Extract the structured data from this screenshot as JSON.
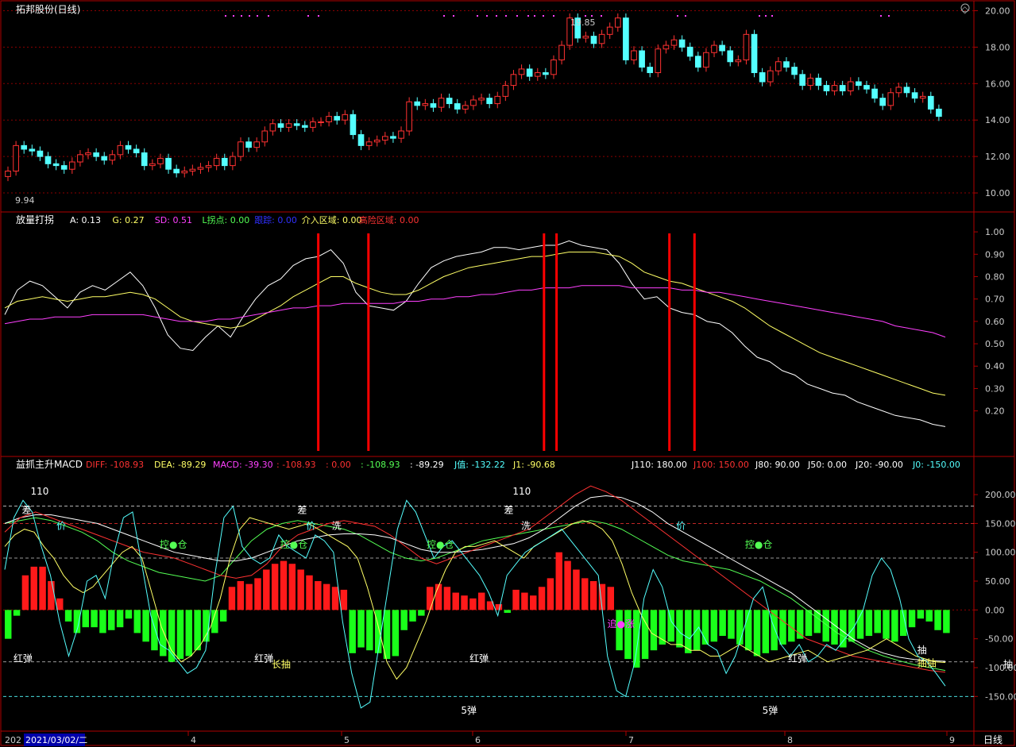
{
  "title": "拓邦股份(日线)",
  "period_label": "日线",
  "date_cursor": "2021/03/02/二",
  "date_prefix": "202",
  "x_axis_labels": [
    "4",
    "5",
    "6",
    "7",
    "8",
    "9"
  ],
  "colors": {
    "up": "#ff3232",
    "down": "#54ffff",
    "grid": "#8b0000",
    "frame": "#b00000",
    "bg": "#000000"
  },
  "chart_data": [
    {
      "type": "candlestick",
      "title": "拓邦股份(日线)",
      "ylim": [
        9.0,
        20.5
      ],
      "yticks": [
        "10.00",
        "12.00",
        "14.00",
        "16.00",
        "18.00",
        "20.00"
      ],
      "high_label": "19.85",
      "low_label": "9.94",
      "closes": [
        11.2,
        12.6,
        12.4,
        12.3,
        12.0,
        11.6,
        11.5,
        11.3,
        11.7,
        12.1,
        12.2,
        12.0,
        11.8,
        12.1,
        12.6,
        12.4,
        12.2,
        11.5,
        11.6,
        11.9,
        11.3,
        11.1,
        11.2,
        11.3,
        11.4,
        11.5,
        11.9,
        11.5,
        12.0,
        12.8,
        12.5,
        12.8,
        13.4,
        13.8,
        13.6,
        13.8,
        13.7,
        13.6,
        13.9,
        13.9,
        14.2,
        14.0,
        14.3,
        13.2,
        12.6,
        12.8,
        12.9,
        13.1,
        13.0,
        13.4,
        15.0,
        14.8,
        14.9,
        14.7,
        15.2,
        14.9,
        14.6,
        14.8,
        15.1,
        15.2,
        14.9,
        15.3,
        15.9,
        16.5,
        16.8,
        16.4,
        16.6,
        16.5,
        17.3,
        18.1,
        19.6,
        18.5,
        18.6,
        18.2,
        18.7,
        19.1,
        19.6,
        17.3,
        17.8,
        16.9,
        16.6,
        17.9,
        18.1,
        18.4,
        18.0,
        17.5,
        16.9,
        17.7,
        18.1,
        17.8,
        17.2,
        17.3,
        18.7,
        16.6,
        16.1,
        16.7,
        17.2,
        16.9,
        16.5,
        15.9,
        16.3,
        15.9,
        15.6,
        15.9,
        15.6,
        16.1,
        15.9,
        15.7,
        15.2,
        14.8,
        15.5,
        15.8,
        15.5,
        15.2,
        15.3,
        14.6,
        14.2
      ]
    },
    {
      "type": "line",
      "title": "放量打拐",
      "ylim": [
        0.0,
        1.05
      ],
      "yticks": [
        "0.20",
        "0.30",
        "0.40",
        "0.50",
        "0.60",
        "0.70",
        "0.80",
        "0.90",
        "1.00"
      ],
      "legend": [
        {
          "label": "A:",
          "value": "0.13",
          "color": "#ffffff"
        },
        {
          "label": "G:",
          "value": "0.27",
          "color": "#ffff66"
        },
        {
          "label": "SD:",
          "value": "0.51",
          "color": "#ff40ff"
        },
        {
          "label": "L拐点:",
          "value": "0.00",
          "color": "#54ff54"
        },
        {
          "label": "跟踪:",
          "value": "0.00",
          "color": "#3030ff"
        },
        {
          "label": "介入区域:",
          "value": "0.00",
          "color": "#ffff66"
        },
        {
          "label": "高险区域:",
          "value": "0.00",
          "color": "#ff3232"
        }
      ],
      "series": [
        {
          "name": "A",
          "color": "#ffffff",
          "values": [
            0.63,
            0.74,
            0.78,
            0.76,
            0.71,
            0.66,
            0.73,
            0.76,
            0.74,
            0.78,
            0.82,
            0.76,
            0.66,
            0.54,
            0.48,
            0.47,
            0.53,
            0.58,
            0.53,
            0.62,
            0.7,
            0.76,
            0.79,
            0.85,
            0.88,
            0.89,
            0.92,
            0.86,
            0.73,
            0.67,
            0.66,
            0.65,
            0.69,
            0.77,
            0.84,
            0.87,
            0.89,
            0.9,
            0.91,
            0.93,
            0.93,
            0.92,
            0.93,
            0.94,
            0.94,
            0.96,
            0.94,
            0.93,
            0.92,
            0.86,
            0.77,
            0.7,
            0.71,
            0.66,
            0.64,
            0.63,
            0.6,
            0.59,
            0.55,
            0.49,
            0.44,
            0.42,
            0.38,
            0.36,
            0.32,
            0.3,
            0.28,
            0.27,
            0.24,
            0.22,
            0.2,
            0.18,
            0.17,
            0.16,
            0.14,
            0.13
          ]
        },
        {
          "name": "G",
          "color": "#ffff66",
          "values": [
            0.66,
            0.69,
            0.7,
            0.71,
            0.7,
            0.69,
            0.7,
            0.71,
            0.71,
            0.72,
            0.73,
            0.72,
            0.7,
            0.66,
            0.62,
            0.6,
            0.59,
            0.58,
            0.57,
            0.58,
            0.61,
            0.64,
            0.67,
            0.71,
            0.74,
            0.77,
            0.8,
            0.8,
            0.77,
            0.75,
            0.73,
            0.72,
            0.72,
            0.74,
            0.77,
            0.8,
            0.82,
            0.84,
            0.85,
            0.86,
            0.87,
            0.88,
            0.89,
            0.89,
            0.9,
            0.91,
            0.91,
            0.91,
            0.9,
            0.89,
            0.86,
            0.82,
            0.8,
            0.78,
            0.77,
            0.75,
            0.73,
            0.71,
            0.69,
            0.66,
            0.62,
            0.58,
            0.55,
            0.52,
            0.49,
            0.46,
            0.44,
            0.42,
            0.4,
            0.38,
            0.36,
            0.34,
            0.32,
            0.3,
            0.28,
            0.27
          ]
        },
        {
          "name": "SD",
          "color": "#ff40ff",
          "values": [
            0.59,
            0.6,
            0.61,
            0.61,
            0.62,
            0.62,
            0.62,
            0.63,
            0.63,
            0.63,
            0.63,
            0.63,
            0.62,
            0.61,
            0.6,
            0.6,
            0.6,
            0.61,
            0.61,
            0.62,
            0.63,
            0.64,
            0.65,
            0.66,
            0.66,
            0.67,
            0.67,
            0.68,
            0.68,
            0.68,
            0.68,
            0.68,
            0.69,
            0.69,
            0.7,
            0.7,
            0.71,
            0.71,
            0.72,
            0.72,
            0.73,
            0.74,
            0.74,
            0.75,
            0.75,
            0.75,
            0.76,
            0.76,
            0.76,
            0.76,
            0.75,
            0.75,
            0.75,
            0.75,
            0.74,
            0.74,
            0.73,
            0.73,
            0.72,
            0.71,
            0.7,
            0.69,
            0.68,
            0.67,
            0.66,
            0.65,
            0.64,
            0.63,
            0.62,
            0.61,
            0.6,
            0.58,
            0.57,
            0.56,
            0.55,
            0.53
          ]
        }
      ],
      "signal_bar_indices": [
        25,
        29,
        43,
        44,
        53,
        55
      ]
    },
    {
      "type": "bar",
      "title": "益抓主升MACD",
      "ylim": [
        -195,
        240
      ],
      "yticks": [
        "-150.00",
        "-100.00",
        "-50.00",
        "0.00",
        "50.00",
        "100.00",
        "150.00",
        "200.00"
      ],
      "legend": [
        {
          "label": "DIFF:",
          "value": "-108.93",
          "color": "#ff3232"
        },
        {
          "label": "DEA:",
          "value": "-89.29",
          "color": "#ffff66"
        },
        {
          "label": "MACD:",
          "value": "-39.30",
          "color": "#ff40ff"
        },
        {
          "label": ":",
          "value": "-108.93",
          "color": "#ff3232"
        },
        {
          "label": ":",
          "value": "0.00",
          "color": "#ff3232"
        },
        {
          "label": ":",
          "value": "-108.93",
          "color": "#54ff54"
        },
        {
          "label": ":",
          "value": "-89.29",
          "color": "#ffffff"
        },
        {
          "label": "J值:",
          "value": "-132.22",
          "color": "#54ffff"
        },
        {
          "label": "J1:",
          "value": "-90.68",
          "color": "#ffff66"
        }
      ],
      "legend_right": [
        {
          "label": "J110:",
          "value": "180.00",
          "color": "#ffffff"
        },
        {
          "label": "J100:",
          "value": "150.00",
          "color": "#ff3232"
        },
        {
          "label": "J80:",
          "value": "90.00",
          "color": "#ffffff"
        },
        {
          "label": "J50:",
          "value": "0.00",
          "color": "#ffffff"
        },
        {
          "label": "J20:",
          "value": "-90.00",
          "color": "#ffffff"
        },
        {
          "label": "J0:",
          "value": "-150.00",
          "color": "#54ffff"
        }
      ],
      "hlines": [
        180,
        150,
        90,
        -90,
        -150
      ],
      "histogram": [
        -50,
        -10,
        60,
        75,
        75,
        50,
        20,
        -20,
        -40,
        -30,
        -30,
        -40,
        -35,
        -30,
        -15,
        -40,
        -55,
        -70,
        -80,
        -90,
        -85,
        -80,
        -70,
        -55,
        -40,
        -20,
        40,
        50,
        45,
        55,
        70,
        80,
        85,
        80,
        70,
        60,
        50,
        45,
        40,
        35,
        -75,
        -65,
        -70,
        -75,
        -85,
        -80,
        -35,
        -20,
        -10,
        40,
        45,
        40,
        30,
        25,
        20,
        30,
        15,
        10,
        -5,
        35,
        30,
        25,
        40,
        55,
        100,
        85,
        70,
        55,
        50,
        45,
        40,
        -70,
        -85,
        -100,
        -85,
        -70,
        -60,
        -55,
        -65,
        -75,
        -70,
        -60,
        -55,
        -45,
        -50,
        -60,
        -70,
        -80,
        -75,
        -70,
        -60,
        -55,
        -50,
        -45,
        -40,
        -55,
        -60,
        -65,
        -55,
        -50,
        -45,
        -40,
        -50,
        -55,
        -45,
        -30,
        -15,
        -20,
        -35,
        -40
      ],
      "j_values": [
        70,
        160,
        190,
        170,
        110,
        60,
        -20,
        -80,
        -30,
        50,
        60,
        20,
        100,
        160,
        170,
        80,
        -10,
        -60,
        -70,
        -90,
        -110,
        -100,
        -70,
        60,
        160,
        180,
        110,
        90,
        80,
        90,
        130,
        110,
        100,
        90,
        130,
        120,
        100,
        -20,
        -110,
        -170,
        -160,
        -60,
        40,
        140,
        190,
        170,
        130,
        90,
        110,
        120,
        100,
        80,
        60,
        30,
        -10,
        60,
        80,
        100,
        110,
        120,
        130,
        140,
        120,
        100,
        80,
        60,
        -80,
        -140,
        -150,
        -90,
        20,
        70,
        40,
        -20,
        -40,
        -50,
        -30,
        -60,
        -70,
        -110,
        -80,
        -30,
        20,
        40,
        -20,
        -60,
        -80,
        -60,
        -90,
        -80,
        -60,
        -70,
        -50,
        -30,
        0,
        60,
        90,
        70,
        20,
        -50,
        -80,
        -90,
        -110,
        -132
      ],
      "j1_values": [
        110,
        130,
        140,
        135,
        110,
        90,
        60,
        40,
        30,
        40,
        60,
        80,
        100,
        110,
        90,
        30,
        -30,
        -70,
        -90,
        -80,
        -60,
        -30,
        20,
        90,
        140,
        160,
        155,
        150,
        145,
        140,
        145,
        150,
        140,
        130,
        120,
        110,
        90,
        40,
        -20,
        -90,
        -120,
        -100,
        -60,
        -20,
        30,
        70,
        100,
        110,
        110,
        115,
        120,
        110,
        100,
        90,
        110,
        120,
        130,
        140,
        150,
        155,
        150,
        140,
        120,
        80,
        30,
        -10,
        -40,
        -50,
        -60,
        -60,
        -70,
        -70,
        -80,
        -80,
        -70,
        -60,
        -70,
        -80,
        -90,
        -85,
        -80,
        -75,
        -70,
        -80,
        -90,
        -85,
        -80,
        -75,
        -70,
        -60,
        -50,
        -60,
        -70,
        -80,
        -85,
        -90,
        -91
      ],
      "diff_values": [
        135,
        160,
        170,
        160,
        150,
        140,
        130,
        120,
        110,
        100,
        95,
        90,
        80,
        70,
        60,
        55,
        60,
        80,
        110,
        130,
        140,
        150,
        155,
        150,
        145,
        130,
        110,
        90,
        80,
        90,
        100,
        110,
        120,
        130,
        140,
        160,
        180,
        200,
        215,
        205,
        190,
        170,
        150,
        130,
        110,
        90,
        70,
        50,
        30,
        10,
        -10,
        -30,
        -50,
        -60,
        -70,
        -80,
        -85,
        -90,
        -95,
        -100,
        -105,
        -108
      ],
      "dea_values": [
        150,
        160,
        165,
        165,
        160,
        155,
        150,
        140,
        130,
        120,
        110,
        100,
        95,
        90,
        85,
        85,
        90,
        100,
        110,
        120,
        125,
        130,
        132,
        132,
        130,
        125,
        115,
        105,
        100,
        100,
        102,
        105,
        110,
        115,
        125,
        140,
        160,
        180,
        195,
        198,
        195,
        185,
        170,
        150,
        135,
        120,
        105,
        90,
        75,
        60,
        45,
        30,
        10,
        -10,
        -30,
        -50,
        -65,
        -75,
        -82,
        -86,
        -88,
        -89
      ],
      "green_values": [
        150,
        155,
        160,
        155,
        145,
        135,
        120,
        100,
        85,
        75,
        65,
        60,
        55,
        50,
        60,
        90,
        120,
        140,
        150,
        155,
        150,
        145,
        140,
        130,
        115,
        100,
        90,
        85,
        90,
        100,
        110,
        120,
        125,
        130,
        135,
        140,
        145,
        150,
        155,
        150,
        140,
        125,
        110,
        95,
        85,
        80,
        75,
        70,
        60,
        50,
        35,
        20,
        0,
        -20,
        -40,
        -55,
        -70,
        -80,
        -88,
        -95,
        -100,
        -105
      ],
      "labels": [
        {
          "text": "110",
          "color": "#ffffff",
          "i": 3,
          "v": 200
        },
        {
          "text": "差",
          "color": "#ffffff",
          "i": 2,
          "v": 168
        },
        {
          "text": "价",
          "color": "#54ffff",
          "i": 6,
          "v": 140
        },
        {
          "text": "控●仓",
          "color": "#54ff54",
          "i": 18,
          "v": 108
        },
        {
          "text": "差",
          "color": "#ffffff",
          "i": 34,
          "v": 168
        },
        {
          "text": "价",
          "color": "#54ffff",
          "i": 35,
          "v": 140
        },
        {
          "text": "洗",
          "color": "#ffffff",
          "i": 38,
          "v": 140
        },
        {
          "text": "控●仓",
          "color": "#54ff54",
          "i": 32,
          "v": 108
        },
        {
          "text": "控●仓",
          "color": "#54ff54",
          "i": 49,
          "v": 108
        },
        {
          "text": "110",
          "color": "#ffffff",
          "i": 59,
          "v": 200
        },
        {
          "text": "差",
          "color": "#ffffff",
          "i": 58,
          "v": 168
        },
        {
          "text": "洗",
          "color": "#ffffff",
          "i": 60,
          "v": 140
        },
        {
          "text": "价",
          "color": "#54ffff",
          "i": 78,
          "v": 140
        },
        {
          "text": "控●仓",
          "color": "#54ff54",
          "i": 86,
          "v": 108
        },
        {
          "text": "追●涨",
          "color": "#ff40ff",
          "i": 70,
          "v": -30
        },
        {
          "text": "红弹",
          "color": "#ffffff",
          "i": 1,
          "v": -90
        },
        {
          "text": "红弹",
          "color": "#ffffff",
          "i": 29,
          "v": -90
        },
        {
          "text": "长抽",
          "color": "#ffff66",
          "i": 31,
          "v": -100
        },
        {
          "text": "红弹",
          "color": "#ffffff",
          "i": 54,
          "v": -90
        },
        {
          "text": "5弹",
          "color": "#ffffff",
          "i": 53,
          "v": -180
        },
        {
          "text": "红弹",
          "color": "#ffffff",
          "i": 91,
          "v": -90
        },
        {
          "text": "5弹",
          "color": "#ffffff",
          "i": 88,
          "v": -180
        },
        {
          "text": "抽",
          "color": "#ffffff",
          "i": 106,
          "v": -75
        },
        {
          "text": "抽抽",
          "color": "#ffff66",
          "i": 106,
          "v": -98
        },
        {
          "text": "抽",
          "color": "#ffffff",
          "i": 118,
          "v": -77
        },
        {
          "text": "抽",
          "color": "#ffffff",
          "i": 122,
          "v": -77
        },
        {
          "text": "抽",
          "color": "#ffffff",
          "i": 116,
          "v": -100
        },
        {
          "text": "长抽",
          "color": "#ffff66",
          "i": 124,
          "v": -100
        }
      ]
    }
  ]
}
